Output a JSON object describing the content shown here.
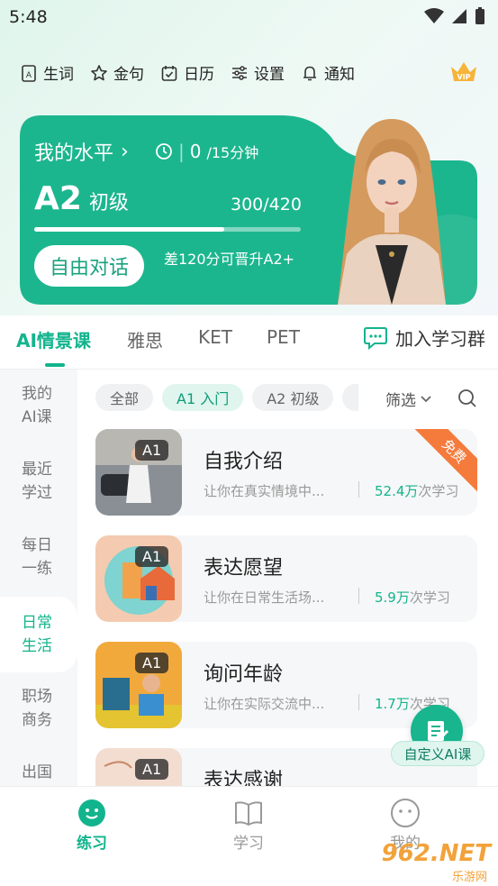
{
  "status": {
    "time": "5:48"
  },
  "toolbar": {
    "items": [
      {
        "label": "生词",
        "icon": "vocab-icon"
      },
      {
        "label": "金句",
        "icon": "star-icon"
      },
      {
        "label": "日历",
        "icon": "calendar-icon"
      },
      {
        "label": "设置",
        "icon": "settings-icon"
      },
      {
        "label": "通知",
        "icon": "bell-icon"
      }
    ],
    "vip_label": "VIP"
  },
  "level_card": {
    "title": "我的水平",
    "timer_value": "0",
    "timer_total": "/15分钟",
    "level": "A2",
    "level_name": "初级",
    "score": "300/420",
    "progress": 0.714,
    "button": "自由对话",
    "hint": "差120分可晋升A2+"
  },
  "tabs": {
    "items": [
      "AI情景课",
      "雅思",
      "KET",
      "PET"
    ],
    "active": 0,
    "join_group": "加入学习群"
  },
  "sidebar": {
    "items": [
      {
        "label1": "我的",
        "label2": "AI课"
      },
      {
        "label1": "最近",
        "label2": "学过"
      },
      {
        "label1": "每日",
        "label2": "一练"
      },
      {
        "label1": "日常",
        "label2": "生活"
      },
      {
        "label1": "职场",
        "label2": "商务"
      },
      {
        "label1": "出国",
        "label2": ""
      }
    ],
    "active": 3
  },
  "filters": {
    "chips": [
      "全部",
      "A1 入门",
      "A2 初级"
    ],
    "active": 1,
    "select_label": "筛选"
  },
  "courses": [
    {
      "badge": "A1",
      "title": "自我介绍",
      "desc": "让你在真实情境中...",
      "count_num": "52.4万",
      "count_suffix": "次学习",
      "ribbon": "免费"
    },
    {
      "badge": "A1",
      "title": "表达愿望",
      "desc": "让你在日常生活场...",
      "count_num": "5.9万",
      "count_suffix": "次学习",
      "ribbon": ""
    },
    {
      "badge": "A1",
      "title": "询问年龄",
      "desc": "让你在实际交流中...",
      "count_num": "1.7万",
      "count_suffix": "次学习",
      "ribbon": ""
    },
    {
      "badge": "A1",
      "title": "表达感谢",
      "desc": "",
      "count_num": "",
      "count_suffix": "",
      "ribbon": ""
    }
  ],
  "fab": {
    "label": "自定义AI课"
  },
  "bottom_nav": {
    "items": [
      "练习",
      "学习",
      "我的"
    ],
    "active": 0
  },
  "watermark": {
    "main": "962.NET",
    "sub": "乐游网"
  },
  "colors": {
    "accent": "#12b48d",
    "card": "#1cb68e",
    "ribbon": "#f57b3d"
  }
}
